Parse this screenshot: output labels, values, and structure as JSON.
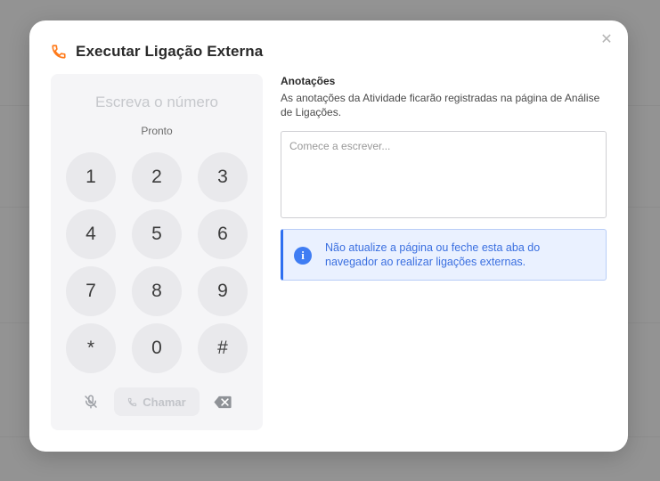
{
  "modal": {
    "title": "Executar Ligação Externa",
    "close_icon": "close-icon",
    "header_icon": "phone-icon",
    "accent_color": "#ff7a1a"
  },
  "dialer": {
    "number_placeholder": "Escreva o número",
    "status": "Pronto",
    "keys": [
      "1",
      "2",
      "3",
      "4",
      "5",
      "6",
      "7",
      "8",
      "9",
      "*",
      "0",
      "#"
    ],
    "mute_icon": "microphone-off-icon",
    "call_label": "Chamar",
    "call_icon": "phone-icon",
    "backspace_icon": "backspace-icon"
  },
  "notes": {
    "title": "Anotações",
    "description": "As anotações da Atividade ficarão registradas na página de Análise de Ligações.",
    "placeholder": "Comece a escrever..."
  },
  "alert": {
    "icon": "info-icon",
    "text": "Não atualize a página ou feche esta aba do navegador ao realizar ligações externas.",
    "color": "#3a6fe0"
  }
}
